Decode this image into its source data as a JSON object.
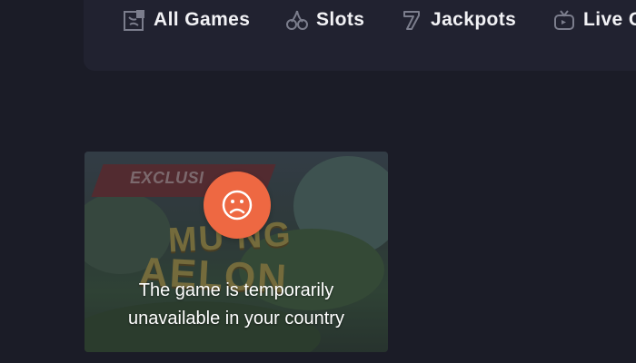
{
  "nav": {
    "items": [
      {
        "label": "All Games",
        "icon": "all-games-icon"
      },
      {
        "label": "Slots",
        "icon": "cherries-icon"
      },
      {
        "label": "Jackpots",
        "icon": "seven-icon"
      },
      {
        "label": "Live C",
        "icon": "tv-icon"
      }
    ]
  },
  "game_card": {
    "badge": "EXCLUSI",
    "art_title_lines": [
      "MU NG",
      "AELON"
    ],
    "status_icon": "sad-face-icon",
    "message_lines": [
      "The game is temporarily",
      "unavailable in your country"
    ]
  },
  "colors": {
    "background": "#1b1c27",
    "nav_background": "#212230",
    "nav_text": "#f2f2f5",
    "status_badge": "#ee6842",
    "exclusive_strip": "#6a3133"
  }
}
